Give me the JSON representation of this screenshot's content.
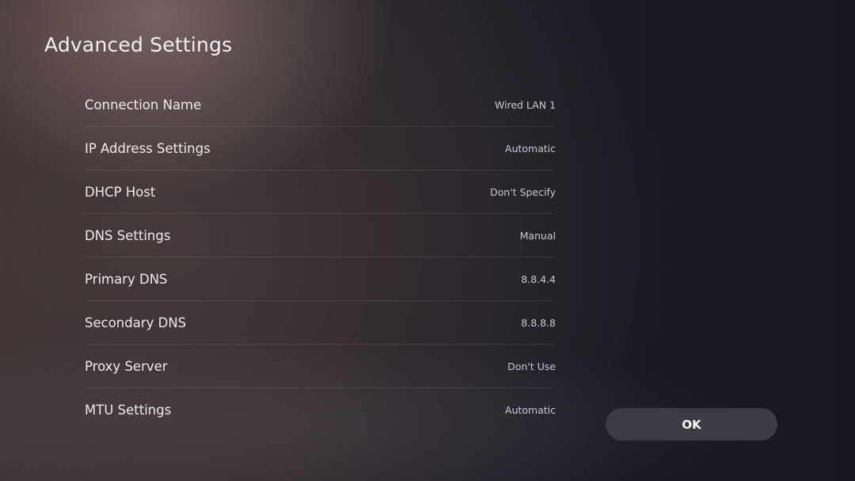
{
  "header": {
    "title": "Advanced Settings"
  },
  "settings": [
    {
      "label": "Connection Name",
      "value": "Wired LAN 1"
    },
    {
      "label": "IP Address Settings",
      "value": "Automatic"
    },
    {
      "label": "DHCP Host",
      "value": "Don't Specify"
    },
    {
      "label": "DNS Settings",
      "value": "Manual"
    },
    {
      "label": "Primary DNS",
      "value": "8.8.4.4"
    },
    {
      "label": "Secondary DNS",
      "value": "8.8.8.8"
    },
    {
      "label": "Proxy Server",
      "value": "Don't Use"
    },
    {
      "label": "MTU Settings",
      "value": "Automatic"
    }
  ],
  "actions": {
    "ok_label": "OK"
  }
}
